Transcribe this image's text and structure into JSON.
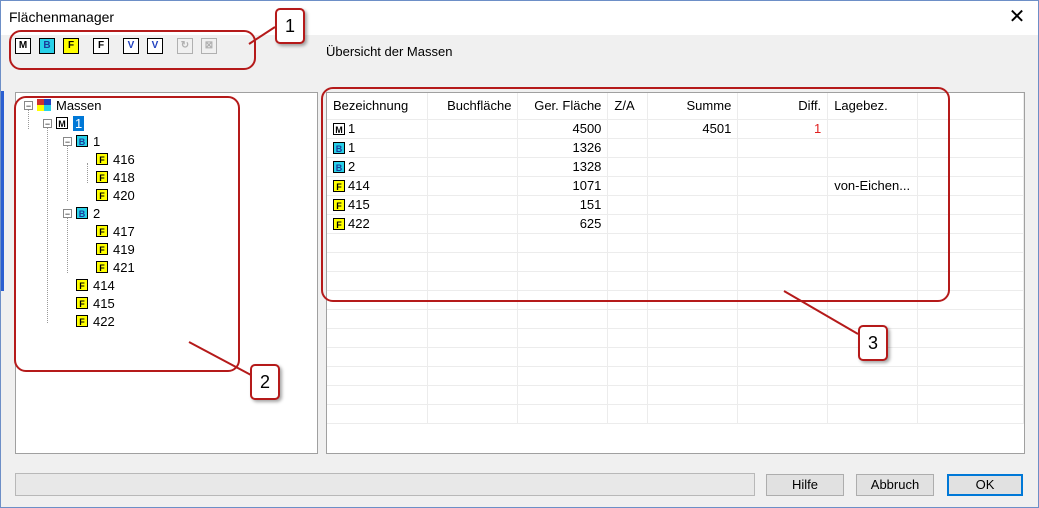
{
  "window": {
    "title": "Flächenmanager",
    "close_glyph": "✕"
  },
  "toolbar": {
    "buttons": [
      {
        "glyph": "M",
        "kind": "m",
        "enabled": true
      },
      {
        "glyph": "B",
        "kind": "b",
        "enabled": true
      },
      {
        "glyph": "F",
        "kind": "f",
        "enabled": true
      },
      {
        "glyph": "F",
        "kind": "m",
        "enabled": true
      },
      {
        "glyph": "V",
        "kind": "v",
        "enabled": true
      },
      {
        "glyph": "V",
        "kind": "v",
        "enabled": true
      },
      {
        "glyph": "↻",
        "kind": "dis",
        "enabled": false
      },
      {
        "glyph": "⊠",
        "kind": "dis",
        "enabled": false
      }
    ]
  },
  "overview_label": "Übersicht der Massen",
  "tree": {
    "root": "Massen",
    "nodes": [
      {
        "label": "1",
        "badge": "M",
        "kind": "m",
        "selected": true
      },
      {
        "label": "1",
        "badge": "B",
        "kind": "b"
      },
      {
        "label": "416",
        "badge": "F",
        "kind": "f"
      },
      {
        "label": "418",
        "badge": "F",
        "kind": "f"
      },
      {
        "label": "420",
        "badge": "F",
        "kind": "f"
      },
      {
        "label": "2",
        "badge": "B",
        "kind": "b"
      },
      {
        "label": "417",
        "badge": "F",
        "kind": "f"
      },
      {
        "label": "419",
        "badge": "F",
        "kind": "f"
      },
      {
        "label": "421",
        "badge": "F",
        "kind": "f"
      },
      {
        "label": "414",
        "badge": "F",
        "kind": "f"
      },
      {
        "label": "415",
        "badge": "F",
        "kind": "f"
      },
      {
        "label": "422",
        "badge": "F",
        "kind": "f"
      }
    ]
  },
  "grid": {
    "columns": [
      "Bezeichnung",
      "Buchfläche",
      "Ger. Fläche",
      "Z/A",
      "Summe",
      "Diff.",
      "Lagebez."
    ],
    "rows": [
      {
        "badge": "M",
        "kind": "m",
        "name": "1",
        "buch": "",
        "ger": "4500",
        "za": "",
        "summe": "4501",
        "diff": "1",
        "lage": ""
      },
      {
        "badge": "B",
        "kind": "b",
        "name": "1",
        "buch": "",
        "ger": "1326",
        "za": "",
        "summe": "",
        "diff": "",
        "lage": ""
      },
      {
        "badge": "B",
        "kind": "b",
        "name": "2",
        "buch": "",
        "ger": "1328",
        "za": "",
        "summe": "",
        "diff": "",
        "lage": ""
      },
      {
        "badge": "F",
        "kind": "f",
        "name": "414",
        "buch": "",
        "ger": "1071",
        "za": "",
        "summe": "",
        "diff": "",
        "lage": "von-Eichen..."
      },
      {
        "badge": "F",
        "kind": "f",
        "name": "415",
        "buch": "",
        "ger": "151",
        "za": "",
        "summe": "",
        "diff": "",
        "lage": ""
      },
      {
        "badge": "F",
        "kind": "f",
        "name": "422",
        "buch": "",
        "ger": "625",
        "za": "",
        "summe": "",
        "diff": "",
        "lage": ""
      }
    ],
    "empty_rows": 10
  },
  "buttons": {
    "help": "Hilfe",
    "cancel": "Abbruch",
    "ok": "OK"
  },
  "callouts": [
    "1",
    "2",
    "3"
  ],
  "colors": {
    "callout": "#b51a1a",
    "selection": "#0078d7",
    "badge_b": "#28d0e8",
    "badge_f": "#ffff00",
    "diff": "#e02020"
  }
}
